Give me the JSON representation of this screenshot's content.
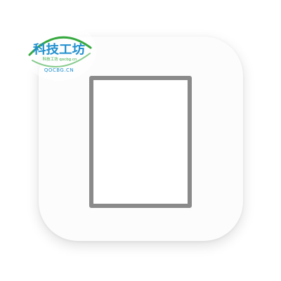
{
  "watermark": {
    "brand_name": "科技工坊",
    "tagline": "科技工坊 qocbg.cn",
    "domain": "QOCBG.CN",
    "colors": {
      "primary": "#1f8fce",
      "accent": "#36a93f"
    }
  },
  "app_icon": {
    "icon": "document-frame-icon",
    "colors": {
      "background": "#fcfcfc",
      "frame_stroke": "#8a8a8a"
    }
  }
}
